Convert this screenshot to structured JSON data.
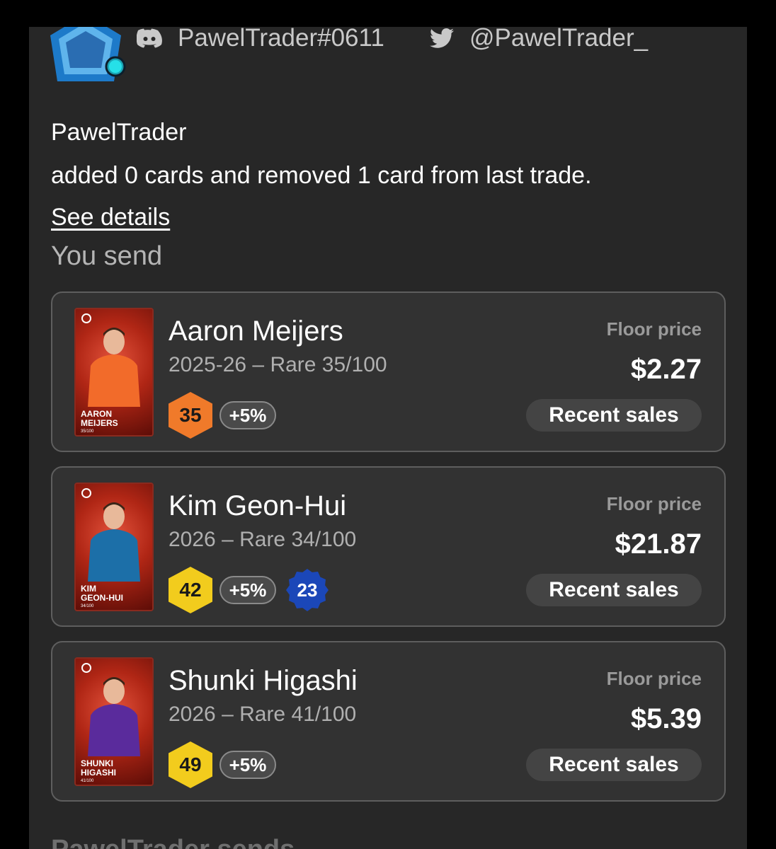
{
  "header": {
    "discord_handle": "PawelTrader#0611",
    "twitter_handle": "@PawelTrader_"
  },
  "trade": {
    "username": "PawelTrader",
    "summary": "added 0 cards and removed 1 card from last trade.",
    "details_link": "See details",
    "you_send_heading": "You send",
    "they_send_heading": "PawelTrader  sends"
  },
  "cards": [
    {
      "name": "Aaron Meijers",
      "season": "2025-26 – Rare 35/100",
      "rating": "35",
      "rating_color": "#f07a2a",
      "bonus": "+5%",
      "floor_label": "Floor price",
      "floor_value": "$2.27",
      "sales_label": "Recent sales",
      "thumb_name": "AARON\nMEIJERS",
      "thumb_serial": "35/100",
      "jersey_color": "#f26b2a"
    },
    {
      "name": "Kim Geon-Hui",
      "season": "2026 – Rare 34/100",
      "rating": "42",
      "rating_color": "#f2cc1d",
      "bonus": "+5%",
      "extra_badge": "23",
      "extra_badge_color": "#1b47b8",
      "floor_label": "Floor price",
      "floor_value": "$21.87",
      "sales_label": "Recent sales",
      "thumb_name": "KIM\nGEON-HUI",
      "thumb_serial": "34/100",
      "jersey_color": "#1c6fa8"
    },
    {
      "name": "Shunki Higashi",
      "season": "2026 – Rare 41/100",
      "rating": "49",
      "rating_color": "#f2cc1d",
      "bonus": "+5%",
      "floor_label": "Floor price",
      "floor_value": "$5.39",
      "sales_label": "Recent sales",
      "thumb_name": "SHUNKI\nHIGASHI",
      "thumb_serial": "41/100",
      "jersey_color": "#5a2b9c"
    }
  ],
  "colors": {
    "panel_bg": "#272727",
    "card_bg": "#323232",
    "card_border": "#5e5e5e"
  }
}
